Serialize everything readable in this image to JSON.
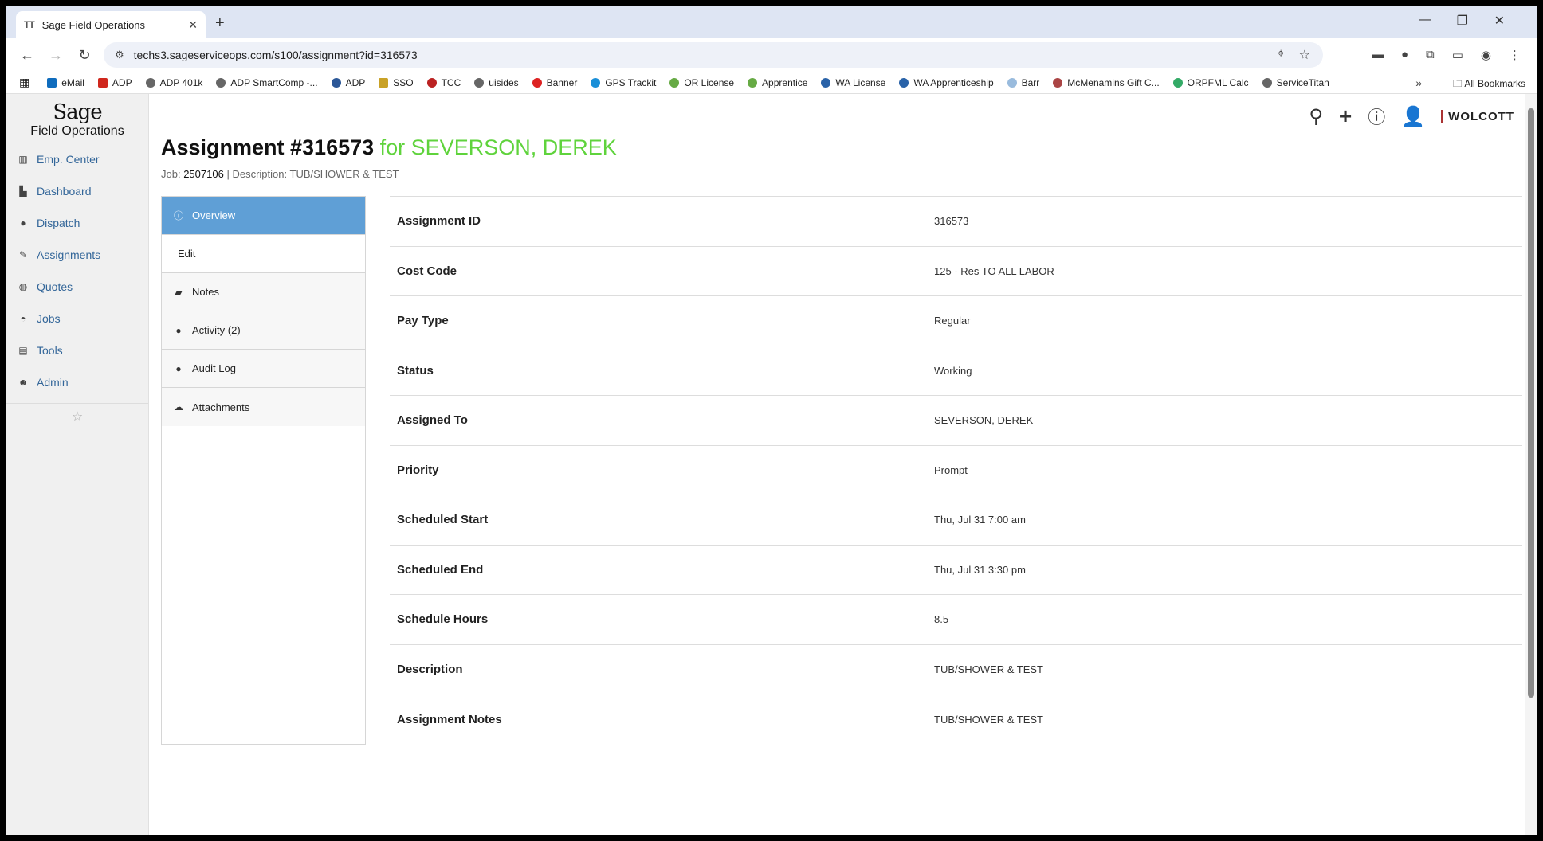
{
  "browser": {
    "tab_title": "Sage Field Operations",
    "tab_favicon": "TT",
    "url": "techs3.sageserviceops.com/s100/assignment?id=316573",
    "bookmarks": [
      "eMail",
      "ADP",
      "ADP 401k",
      "ADP SmartComp -...",
      "ADP",
      "SSO",
      "TCC",
      "uisides",
      "Banner",
      "GPS Trackit",
      "OR License",
      "Apprentice",
      "WA License",
      "WA Apprenticeship",
      "Barr",
      "McMenamins Gift C...",
      "ORPFML Calc",
      "ServiceTitan"
    ],
    "all_bookmarks": "All Bookmarks"
  },
  "logo": {
    "brand": "Sage",
    "product": "Field Operations"
  },
  "sidebar": {
    "items": [
      {
        "label": "Emp. Center",
        "icon": "building-icon"
      },
      {
        "label": "Dashboard",
        "icon": "chart-icon"
      },
      {
        "label": "Dispatch",
        "icon": "map-pin-icon"
      },
      {
        "label": "Assignments",
        "icon": "pin-icon"
      },
      {
        "label": "Quotes",
        "icon": "dollar-icon"
      },
      {
        "label": "Jobs",
        "icon": "hardhat-icon"
      },
      {
        "label": "Tools",
        "icon": "toolbox-icon"
      },
      {
        "label": "Admin",
        "icon": "users-icon"
      }
    ]
  },
  "header": {
    "company": "WOLCOTT"
  },
  "page": {
    "title": "Assignment #316573",
    "for_text": "for SEVERSON, DEREK",
    "job_label": "Job:",
    "job_value": "2507106",
    "separator": "|",
    "description_label": "Description:",
    "description_value": "TUB/SHOWER & TEST"
  },
  "tabs": [
    {
      "label": "Overview"
    },
    {
      "label": "Edit"
    },
    {
      "label": "Notes"
    },
    {
      "label": "Activity (2)"
    },
    {
      "label": "Audit Log"
    },
    {
      "label": "Attachments"
    }
  ],
  "details": [
    {
      "label": "Assignment ID",
      "value": "316573"
    },
    {
      "label": "Cost Code",
      "value": "125 - Res TO ALL LABOR"
    },
    {
      "label": "Pay Type",
      "value": "Regular"
    },
    {
      "label": "Status",
      "value": "Working"
    },
    {
      "label": "Assigned To",
      "value": "SEVERSON, DEREK"
    },
    {
      "label": "Priority",
      "value": "Prompt"
    },
    {
      "label": "Scheduled Start",
      "value": "Thu, Jul 31 7:00 am"
    },
    {
      "label": "Scheduled End",
      "value": "Thu, Jul 31 3:30 pm"
    },
    {
      "label": "Schedule Hours",
      "value": "8.5"
    },
    {
      "label": "Description",
      "value": "TUB/SHOWER & TEST"
    },
    {
      "label": "Assignment Notes",
      "value": "TUB/SHOWER & TEST"
    }
  ]
}
